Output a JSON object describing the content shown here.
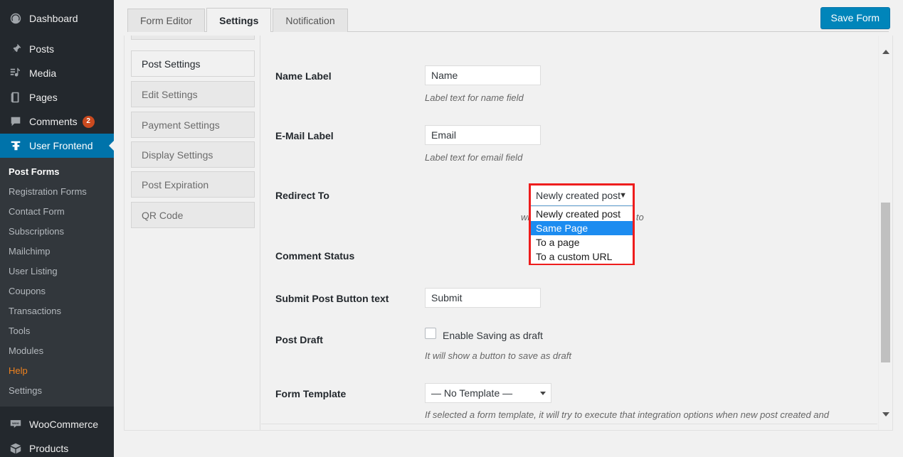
{
  "sidebar": {
    "items": [
      {
        "label": "Dashboard",
        "icon": "dashboard-icon"
      },
      {
        "label": "Posts",
        "icon": "pin-icon"
      },
      {
        "label": "Media",
        "icon": "media-icon"
      },
      {
        "label": "Pages",
        "icon": "pages-icon"
      },
      {
        "label": "Comments",
        "icon": "comment-icon",
        "badge": "2"
      },
      {
        "label": "User Frontend",
        "icon": "wpuf-icon",
        "active": true
      }
    ],
    "submenu": [
      {
        "label": "Post Forms",
        "current": true
      },
      {
        "label": "Registration Forms"
      },
      {
        "label": "Contact Form"
      },
      {
        "label": "Subscriptions"
      },
      {
        "label": "Mailchimp"
      },
      {
        "label": "User Listing"
      },
      {
        "label": "Coupons"
      },
      {
        "label": "Transactions"
      },
      {
        "label": "Tools"
      },
      {
        "label": "Modules"
      },
      {
        "label": "Help",
        "help": true
      },
      {
        "label": "Settings"
      }
    ],
    "bottom_items": [
      {
        "label": "WooCommerce",
        "icon": "woocommerce-icon"
      },
      {
        "label": "Products",
        "icon": "products-icon"
      }
    ]
  },
  "tabs": [
    {
      "label": "Form Editor",
      "active": false
    },
    {
      "label": "Settings",
      "active": true
    },
    {
      "label": "Notification",
      "active": false
    }
  ],
  "toolbar": {
    "save_label": "Save Form"
  },
  "settings_nav": [
    {
      "label": "Post Settings",
      "active": true
    },
    {
      "label": "Edit Settings",
      "active": false
    },
    {
      "label": "Payment Settings",
      "active": false
    },
    {
      "label": "Display Settings",
      "active": false
    },
    {
      "label": "Post Expiration",
      "active": false
    },
    {
      "label": "QR Code",
      "active": false
    }
  ],
  "form": {
    "name_label": {
      "label": "Name Label",
      "value": "Name",
      "desc": "Label text for name field"
    },
    "email_label": {
      "label": "E-Mail Label",
      "value": "Email",
      "desc": "Label text for email field"
    },
    "redirect_to": {
      "label": "Redirect To",
      "value": "Newly created post",
      "desc": "where the page will redirect to",
      "caret": "▼",
      "options": [
        {
          "label": "Newly created post",
          "selected": false
        },
        {
          "label": "Same Page",
          "selected": true
        },
        {
          "label": "To a page",
          "selected": false
        },
        {
          "label": "To a custom URL",
          "selected": false
        }
      ]
    },
    "comment_status": {
      "label": "Comment Status"
    },
    "submit_button_text": {
      "label": "Submit Post Button text",
      "value": "Submit"
    },
    "post_draft": {
      "label": "Post Draft",
      "checkbox_label": "Enable Saving as draft",
      "checked": false,
      "desc": "It will show a button to save as draft"
    },
    "form_template": {
      "label": "Form Template",
      "value": "— No Template —",
      "desc": "If selected a form template, it will try to execute that integration options when new post created and"
    }
  },
  "colors": {
    "accent": "#0073aa",
    "save_button": "#0085ba",
    "highlight_box": "#ee1d1d",
    "option_selected": "#1c8cf0",
    "badge": "#ca4a1f",
    "help_link": "#f0821e"
  }
}
